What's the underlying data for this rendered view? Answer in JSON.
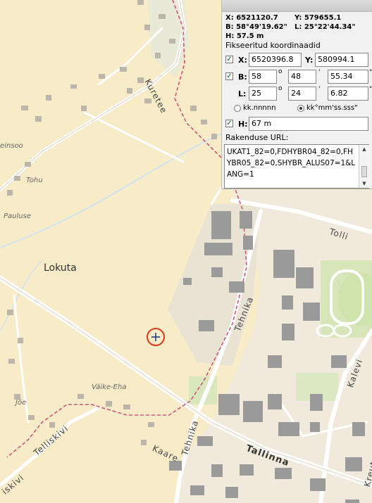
{
  "map": {
    "place_labels": [
      {
        "text": "Lokuta"
      },
      {
        "text": "Väike-Eha"
      },
      {
        "text": "Tohu"
      },
      {
        "text": "Pauluse"
      },
      {
        "text": "Jõe"
      },
      {
        "text": "einsoo"
      }
    ],
    "street_labels": [
      {
        "text": "Kuretee"
      },
      {
        "text": "Tolli"
      },
      {
        "text": "Tehnika"
      },
      {
        "text": "Tehnika"
      },
      {
        "text": "Kalevi"
      },
      {
        "text": "Kreutzw"
      },
      {
        "text": "Tallinna"
      },
      {
        "text": "Kaare"
      },
      {
        "text": "Telliskivi"
      },
      {
        "text": "iskivi"
      }
    ],
    "marker_icon": "crosshair-icon",
    "colors": {
      "background": "#f8ebc8",
      "marker": "#e03a1e",
      "boundary": "#d4547a",
      "building": "#9a9a9a",
      "road": "#ffffff"
    }
  },
  "panel": {
    "readout": {
      "x": "X: 6521120.7",
      "y": "Y: 579655.1",
      "b": "B: 58°49'19.62\"",
      "l": "L: 25°22'44.34\"",
      "h": "H: 57.5 m"
    },
    "fixed_title": "Fikseeritud koordinaadid",
    "x_label": "X:",
    "x_value": "6520396.8",
    "y_label": "Y:",
    "y_value": "580994.1",
    "b_label": "B:",
    "b_deg": "58",
    "b_min": "48",
    "b_sec": "55.34",
    "l_label": "L:",
    "l_deg": "25",
    "l_min": "24",
    "l_sec": "6.82",
    "deg_unit": "o",
    "min_unit": "'",
    "sec_unit": "\"",
    "radio_decimal": "kk.nnnnn",
    "radio_dms": "kk°mm'ss.sss\"",
    "radio_selected": "dms",
    "h_label": "H:",
    "h_value": "67 m",
    "url_label": "Rakenduse URL:",
    "url_value": "UKAT1_82=0,FDHYBR04_82=0,FHYBR05_82=0,SHYBR_ALUS07=1&LANG=1"
  }
}
